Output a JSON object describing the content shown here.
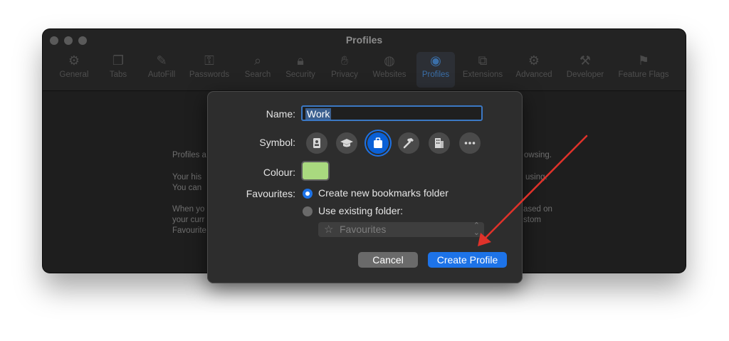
{
  "window": {
    "title": "Profiles",
    "tabs": [
      {
        "label": "General",
        "icon": "gear-icon"
      },
      {
        "label": "Tabs",
        "icon": "tabs-icon"
      },
      {
        "label": "AutoFill",
        "icon": "autofill-icon"
      },
      {
        "label": "Passwords",
        "icon": "key-icon"
      },
      {
        "label": "Search",
        "icon": "search-icon"
      },
      {
        "label": "Security",
        "icon": "lock-icon"
      },
      {
        "label": "Privacy",
        "icon": "hand-icon"
      },
      {
        "label": "Websites",
        "icon": "globe-icon"
      },
      {
        "label": "Profiles",
        "icon": "profiles-icon"
      },
      {
        "label": "Extensions",
        "icon": "extensions-icon"
      },
      {
        "label": "Advanced",
        "icon": "gears-icon"
      },
      {
        "label": "Developer",
        "icon": "tools-icon"
      },
      {
        "label": "Feature Flags",
        "icon": "flags-icon"
      }
    ],
    "active_tab": "Profiles",
    "body_left": [
      "Profiles a",
      "Your his",
      "You can",
      "When yo",
      "your curr",
      "Favourite"
    ],
    "body_right": [
      "owsing.",
      "using.",
      "ased on",
      "stom"
    ]
  },
  "dialog": {
    "name_label": "Name:",
    "name_value": "Work",
    "symbol_label": "Symbol:",
    "symbols": [
      "id-badge-icon",
      "graduation-cap-icon",
      "briefcase-icon",
      "hammer-icon",
      "building-icon",
      "more-icon"
    ],
    "selected_symbol": "briefcase-icon",
    "colour_label": "Colour:",
    "colour_value": "#a9d97f",
    "favourites_label": "Favourites:",
    "option_new": "Create new bookmarks folder",
    "option_existing": "Use existing folder:",
    "selected_option": "Create new bookmarks folder",
    "folder_select_value": "Favourites",
    "cancel_label": "Cancel",
    "create_label": "Create Profile"
  },
  "colors": {
    "accent": "#1d73e8",
    "annotation_arrow": "#e0322a"
  }
}
